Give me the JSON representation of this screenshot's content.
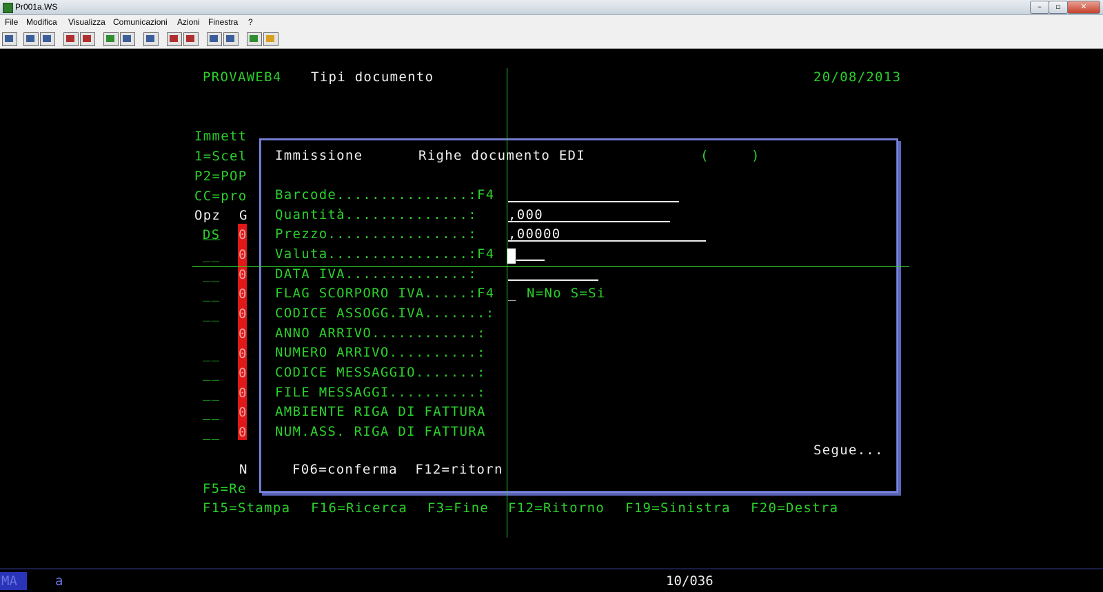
{
  "window": {
    "title": "Pr001a.WS",
    "btn_min": "–",
    "btn_max": "▫",
    "btn_close": "✕"
  },
  "menu": [
    "File",
    "Modifica",
    "Visualizza",
    "Comunicazioni",
    "Azioni",
    "Finestra",
    "?"
  ],
  "toolbar_icons": [
    "print-screen-icon",
    "copy-icon",
    "paste-icon",
    "send-file-icon",
    "receive-file-icon",
    "display-icon",
    "keyboard-map-icon",
    "macro-record-icon",
    "macro-play-icon",
    "macro-stop-icon",
    "macro-edit-icon",
    "macro-run-icon",
    "globe-icon",
    "help-icon"
  ],
  "terminal": {
    "program": "PROVAWEB4",
    "screen_title": "Tipi documento",
    "date": "20/08/2013",
    "left_col": [
      "Immett",
      "1=Scel",
      "P2=POP",
      "CC=pro"
    ],
    "col_opz": "Opz",
    "col_g": "G",
    "first_opt": "DS",
    "opt_blank": "__",
    "red_value": "0",
    "below_n": "N",
    "f5": "F5=Re",
    "fkeys": [
      "F15=Stampa",
      "F16=Ricerca",
      "F3=Fine",
      "F12=Ritorno",
      "F19=Sinistra",
      "F20=Destra"
    ]
  },
  "popup": {
    "mode": "Immissione",
    "title": "Righe documento EDI",
    "paren_open": "(",
    "paren_close": ")",
    "fields": [
      {
        "label": "Barcode...............:F4",
        "value": ""
      },
      {
        "label": "Quantità..............:",
        "value": ",000"
      },
      {
        "label": "Prezzo................:",
        "value": ",00000"
      },
      {
        "label": "Valuta................:F4",
        "value": ""
      },
      {
        "label": "DATA IVA..............:",
        "value": ""
      },
      {
        "label": "FLAG SCORPORO IVA.....:F4",
        "value": "_",
        "hint": "N=No S=Si"
      },
      {
        "label": "CODICE ASSOGG.IVA.......:",
        "value": ""
      },
      {
        "label": "ANNO ARRIVO............:",
        "value": ""
      },
      {
        "label": "NUMERO ARRIVO..........:",
        "value": ""
      },
      {
        "label": "CODICE MESSAGGIO.......:",
        "value": ""
      },
      {
        "label": "FILE MESSAGGI..........:",
        "value": ""
      },
      {
        "label": "AMBIENTE RIGA DI FATTURA",
        "value": ""
      },
      {
        "label": "NUM.ASS. RIGA DI FATTURA",
        "value": ""
      }
    ],
    "more": "Segue...",
    "keys": "F06=conferma  F12=ritorn"
  },
  "status": {
    "mode": "MA",
    "session": "a",
    "cursor_pos": "10/036"
  },
  "colors": {
    "green": "#2bd12b",
    "white": "#f0f0f0",
    "red": "#e01818",
    "blue": "#7a85d8",
    "status_blue": "#6a74e0"
  }
}
